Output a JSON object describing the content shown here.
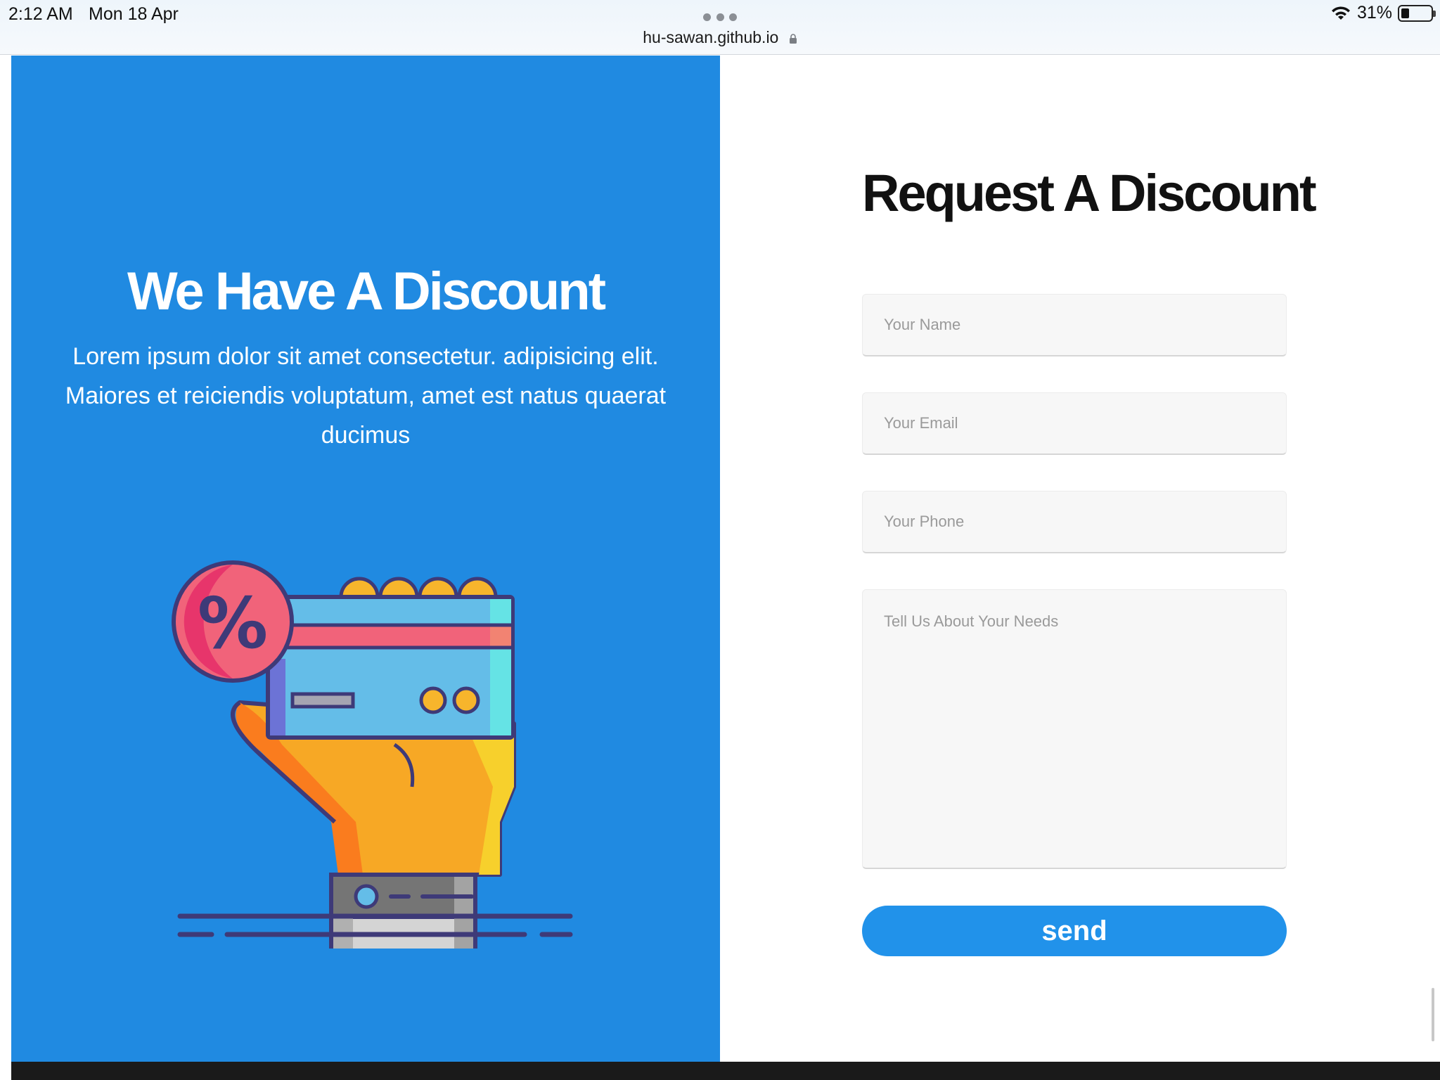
{
  "status_bar": {
    "time": "2:12 AM",
    "date": "Mon 18 Apr",
    "url": "hu-sawan.github.io",
    "battery_percent": "31%",
    "battery_level": 0.31,
    "icons": [
      "wifi-icon",
      "battery-icon",
      "lock-icon"
    ]
  },
  "promo": {
    "title": "We Have A Discount",
    "text": "Lorem ipsum dolor sit amet consectetur. adipisicing elit. Maiores et reiciendis voluptatum, amet est natus quaerat ducimus",
    "background_color": "#208ae1",
    "illustration": "hand-holding-discount-card-illustration"
  },
  "form": {
    "title": "Request A Discount",
    "name_placeholder": "Your Name",
    "email_placeholder": "Your Email",
    "phone_placeholder": "Your Phone",
    "needs_placeholder": "Tell Us About Your Needs",
    "send_label": "send",
    "button_color": "#2192ea"
  }
}
